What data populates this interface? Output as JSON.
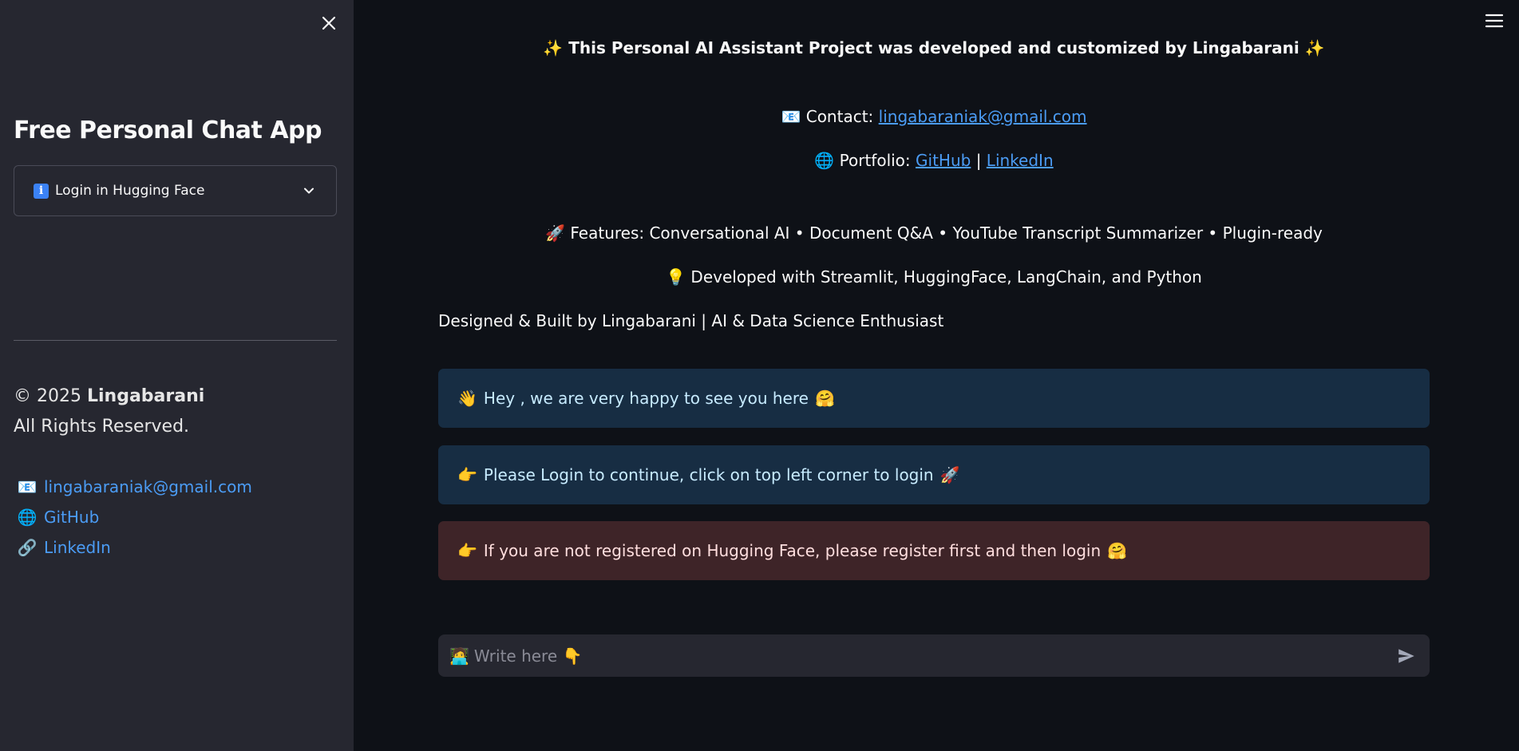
{
  "sidebar": {
    "title": "Free Personal Chat App",
    "expander": {
      "icon_glyph": "i",
      "label": "Login in Hugging Face"
    },
    "copyright_prefix": "© 2025",
    "copyright_name": "Lingabarani",
    "rights": "All Rights Reserved.",
    "links": [
      {
        "icon": "envelope-icon",
        "glyph": "📧",
        "label": "lingabaraniak@gmail.com"
      },
      {
        "icon": "globe-icon",
        "glyph": "🌐",
        "label": "GitHub"
      },
      {
        "icon": "link-icon",
        "glyph": "🔗",
        "label": "LinkedIn"
      }
    ]
  },
  "main": {
    "title": {
      "sparkle": "✨",
      "text": "This Personal AI Assistant Project was developed and customized by Lingabarani"
    },
    "contact": {
      "glyph": "📧",
      "label": "Contact:",
      "email": "lingabaraniak@gmail.com"
    },
    "portfolio": {
      "glyph": "🌐",
      "label": "Portfolio:",
      "github": "GitHub",
      "sep": "|",
      "linkedin": "LinkedIn"
    },
    "features": {
      "glyph": "🚀",
      "text": "Features: Conversational AI • Document Q&A • YouTube Transcript Summarizer • Plugin-ready"
    },
    "developed": {
      "glyph": "💡",
      "text": "Developed with Streamlit, HuggingFace, LangChain, and Python"
    },
    "designed": "Designed & Built by Lingabarani | AI & Data Science Enthusiast",
    "alerts": [
      {
        "glyph_start": "👋",
        "text": "Hey , we are very happy to see you here",
        "glyph_end": "🤗"
      },
      {
        "glyph_start": "👉",
        "text": "Please Login to continue, click on top left corner to login",
        "glyph_end": "🚀"
      },
      {
        "glyph_start": "👉",
        "text": "If you are not registered on Hugging Face, please register first and then login",
        "glyph_end": "🤗"
      }
    ],
    "chat_input": {
      "glyph": "🧑‍💻",
      "placeholder": "Write here 👇"
    }
  },
  "colors": {
    "main_bg": "#0e1117",
    "sidebar_bg": "#262730",
    "link": "#4b9cf5",
    "info_bg": "#172d43",
    "error_bg": "#3e2428"
  }
}
